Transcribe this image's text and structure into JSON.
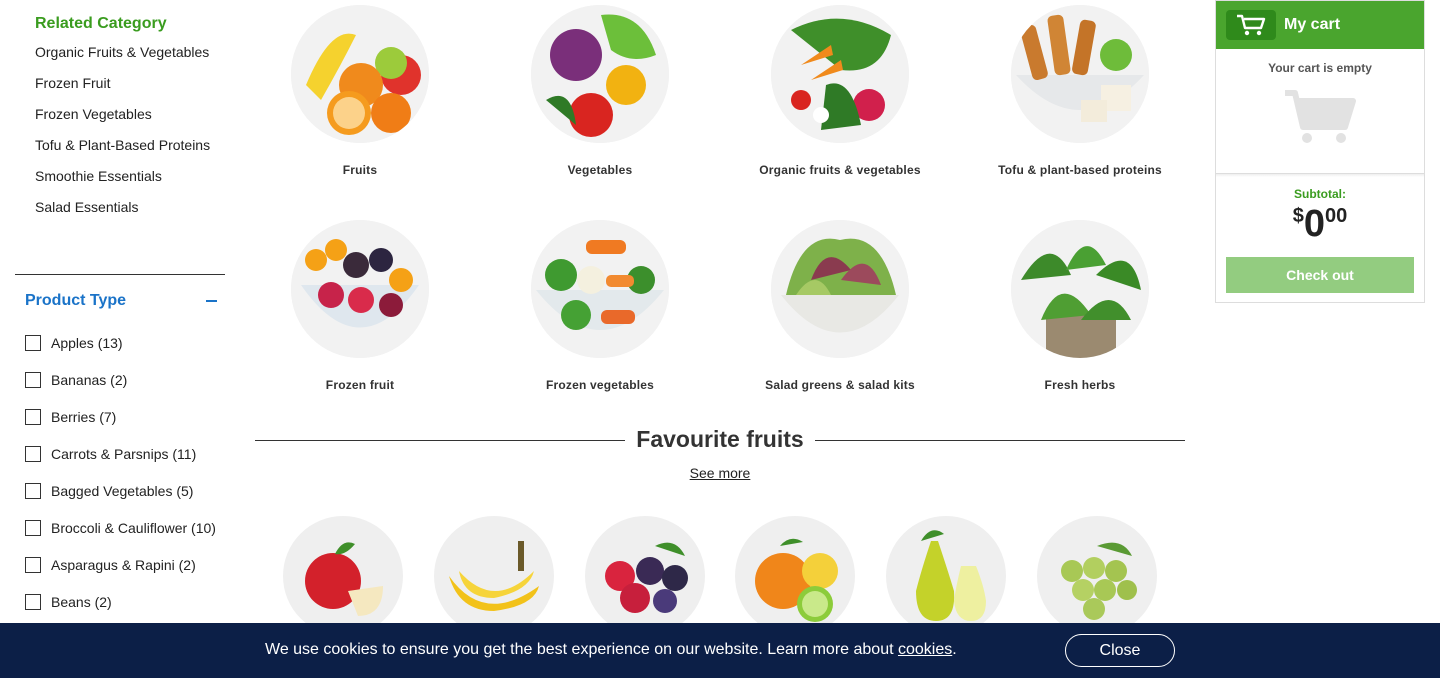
{
  "sidebar": {
    "related_title": "Related Category",
    "related_items": [
      "Organic Fruits & Vegetables",
      "Frozen Fruit",
      "Frozen Vegetables",
      "Tofu & Plant-Based Proteins",
      "Smoothie Essentials",
      "Salad Essentials"
    ],
    "product_type_title": "Product Type",
    "filters": [
      "Apples (13)",
      "Bananas (2)",
      "Berries (7)",
      "Carrots & Parsnips (11)",
      "Bagged Vegetables (5)",
      "Broccoli & Cauliflower (10)",
      "Asparagus & Rapini (2)",
      "Beans (2)"
    ]
  },
  "categories": [
    {
      "label": "Fruits",
      "icon": "fruits-image"
    },
    {
      "label": "Vegetables",
      "icon": "vegetables-image"
    },
    {
      "label": "Organic fruits & vegetables",
      "icon": "organic-produce-image"
    },
    {
      "label": "Tofu & plant-based proteins",
      "icon": "tofu-image"
    },
    {
      "label": "Frozen fruit",
      "icon": "frozen-fruit-image"
    },
    {
      "label": "Frozen vegetables",
      "icon": "frozen-vegetables-image"
    },
    {
      "label": "Salad greens & salad kits",
      "icon": "salad-image"
    },
    {
      "label": "Fresh herbs",
      "icon": "herbs-image"
    }
  ],
  "favourites": {
    "title": "Favourite fruits",
    "see_more": "See more",
    "items": [
      "apple-image",
      "banana-image",
      "berries-image",
      "citrus-image",
      "pear-image",
      "grapes-image"
    ]
  },
  "cart": {
    "title": "My cart",
    "empty_text": "Your cart is empty",
    "subtotal_label": "Subtotal:",
    "currency": "$",
    "amount_whole": "0",
    "amount_cents": "00",
    "checkout_label": "Check out"
  },
  "cookie_bar": {
    "text": "We use cookies to ensure you get the best experience on our website. Learn more about ",
    "link": "cookies",
    "suffix": ".",
    "close_label": "Close"
  },
  "colors": {
    "accent_green": "#4aa52e",
    "link_blue": "#1a73c8",
    "cookie_bg": "#0c1f47",
    "checkout_disabled": "#93cc80"
  }
}
